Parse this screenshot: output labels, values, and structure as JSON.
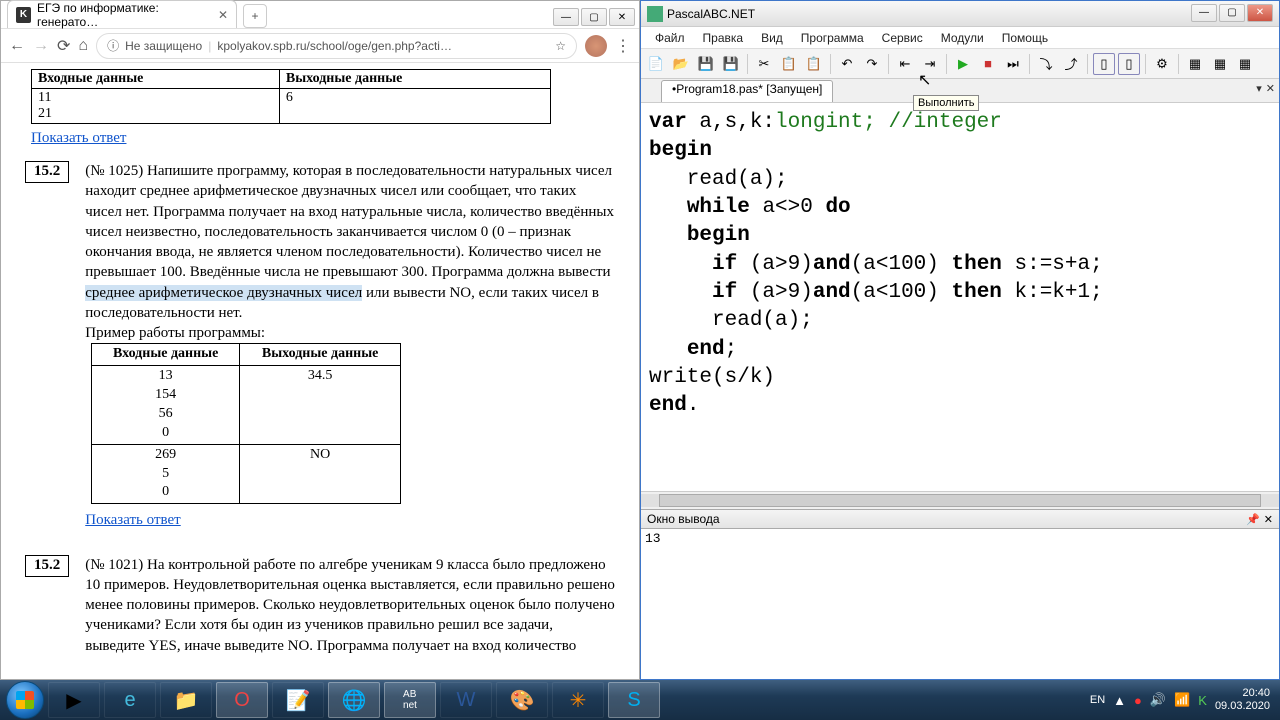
{
  "browser": {
    "tab_title": "ЕГЭ по информатике: генерато…",
    "url_warn": "Не защищено",
    "url": "kpolyakov.spb.ru/school/oge/gen.php?acti…",
    "table_prev": {
      "headers": [
        "Входные данные",
        "Выходные данные"
      ],
      "rows": [
        [
          "11\n21",
          "6"
        ]
      ]
    },
    "show_answer": "Показать ответ",
    "task2": {
      "num": "15.2",
      "prefix": "(№ 1025) Напишите программу, которая в последовательности натуральных чисел находит среднее арифметическое двузначных чисел или сообщает, что таких чисел нет. Программа получает на вход натуральные числа, количество введённых чисел неизвестно, последовательность заканчивается числом 0 (0 – признак окончания ввода, не является членом последовательности). Количество чисел не превышает 100. Введённые числа не превышают 300. Программа должна вывести ",
      "hl": "среднее арифметическое двузначных чисел",
      "suffix": " или вывести NO, если таких чисел в последовательности нет.",
      "example_label": "Пример работы программы:",
      "io": {
        "headers": [
          "Входные данные",
          "Выходные данные"
        ],
        "rows": [
          [
            "13\n154\n56\n0",
            "34.5"
          ],
          [
            "269\n5\n0",
            "NO"
          ]
        ]
      }
    },
    "task3": {
      "num": "15.2",
      "text": "(№ 1021) На контрольной работе по алгебре ученикам 9 класса было предложено 10 примеров. Неудовлетворительная оценка выставляется, если правильно решено менее половины примеров. Сколько неудовлетворительных оценок было получено учениками? Если хотя бы один из учеников правильно решил все задачи, выведите YES, иначе выведите NO. Программа получает на вход количество"
    }
  },
  "ide": {
    "title": "PascalABC.NET",
    "menu": [
      "Файл",
      "Правка",
      "Вид",
      "Программа",
      "Сервис",
      "Модули",
      "Помощь"
    ],
    "tab": "•Program18.pas* [Запущен]",
    "tooltip": "Выполнить",
    "code_lines": [
      {
        "t": "var ",
        "k": "kw",
        "rest": "a,s,k:",
        "ty": "longint",
        "cm": "; //integer"
      },
      {
        "t": "begin",
        "k": "kw"
      },
      {
        "plain": "   read(a);"
      },
      {
        "pre": "   ",
        "t": "while ",
        "k": "kw",
        "rest": "a<>0 ",
        "t2": "do",
        "k2": "kw"
      },
      {
        "pre": "   ",
        "t": "begin",
        "k": "kw"
      },
      {
        "pre": "     ",
        "t": "if ",
        "k": "kw",
        "rest": "(a>9)",
        "t2": "and",
        "k2": "kw",
        "rest2": "(a<100) ",
        "t3": "then ",
        "k3": "kw",
        "rest3": "s:=s+a;"
      },
      {
        "pre": "     ",
        "t": "if ",
        "k": "kw",
        "rest": "(a>9)",
        "t2": "and",
        "k2": "kw",
        "rest2": "(a<100) ",
        "t3": "then ",
        "k3": "kw",
        "rest3": "k:=k+1;"
      },
      {
        "plain": "     read(a);"
      },
      {
        "pre": "   ",
        "t": "end",
        "k": "kw",
        "rest": ";"
      },
      {
        "plain": "write(s/k)"
      },
      {
        "t": "end",
        "k": "kw",
        "rest": "."
      }
    ],
    "output_title": "Окно вывода",
    "output": "13"
  },
  "taskbar": {
    "lang": "EN",
    "time": "20:40",
    "date": "09.03.2020"
  }
}
